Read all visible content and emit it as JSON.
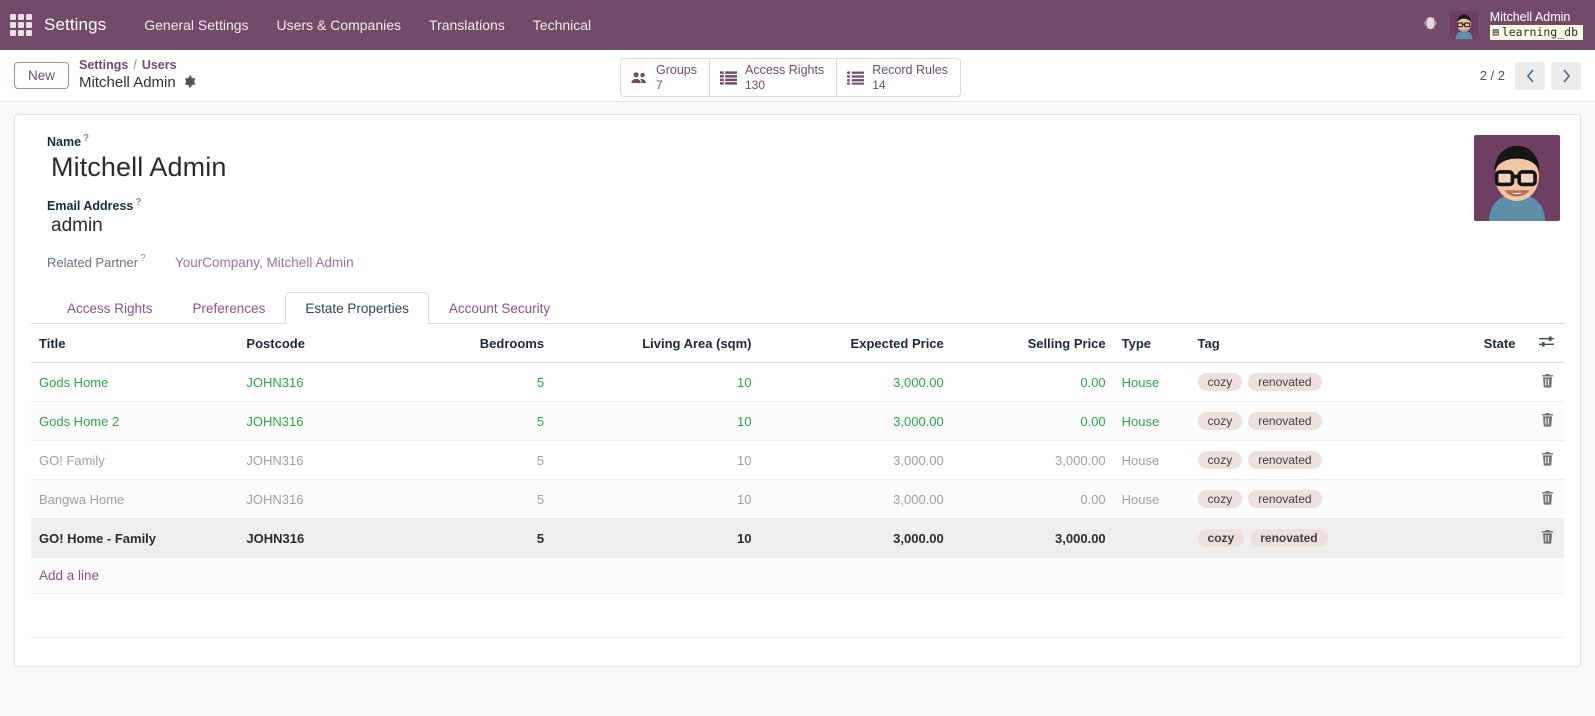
{
  "navbar": {
    "apps_icon": "apps-grid-icon",
    "brand": "Settings",
    "menus": [
      {
        "label": "General Settings"
      },
      {
        "label": "Users & Companies"
      },
      {
        "label": "Translations"
      },
      {
        "label": "Technical"
      }
    ],
    "debug_icon": "bug-icon",
    "user_name": "Mitchell Admin",
    "database": "learning_db",
    "db_icon": "database-icon",
    "brand_color": "#714B67"
  },
  "control_panel": {
    "new_label": "New",
    "breadcrumb": {
      "root": "Settings",
      "separator": "/",
      "parent": "Users",
      "current": "Mitchell Admin",
      "gear_icon": "gear-icon"
    },
    "stat_buttons": [
      {
        "icon": "users-icon",
        "label": "Groups",
        "value": "7"
      },
      {
        "icon": "list-icon",
        "label": "Access Rights",
        "value": "130"
      },
      {
        "icon": "list-ul-icon",
        "label": "Record Rules",
        "value": "14"
      }
    ],
    "pager": {
      "counter": "2 / 2",
      "prev_icon": "chevron-left-icon",
      "next_icon": "chevron-right-icon"
    }
  },
  "form": {
    "name_label": "Name",
    "name_value": "Mitchell Admin",
    "email_label": "Email Address",
    "email_value": "admin",
    "partner_label": "Related Partner",
    "partner_value": "YourCompany, Mitchell Admin",
    "help_mark": "?",
    "avatar_alt": "user-avatar"
  },
  "notebook": {
    "tabs": [
      {
        "label": "Access Rights",
        "active": false
      },
      {
        "label": "Preferences",
        "active": false
      },
      {
        "label": "Estate Properties",
        "active": true
      },
      {
        "label": "Account Security",
        "active": false
      }
    ]
  },
  "list": {
    "columns": [
      {
        "label": "Title",
        "align": "left"
      },
      {
        "label": "Postcode",
        "align": "left"
      },
      {
        "label": "Bedrooms",
        "align": "right"
      },
      {
        "label": "Living Area (sqm)",
        "align": "right"
      },
      {
        "label": "Expected Price",
        "align": "right"
      },
      {
        "label": "Selling Price",
        "align": "right"
      },
      {
        "label": "Type",
        "align": "left"
      },
      {
        "label": "Tag",
        "align": "left"
      },
      {
        "label": "State",
        "align": "right"
      }
    ],
    "optional_columns_icon": "sliders-icon",
    "delete_icon": "trash-icon",
    "rows": [
      {
        "title": "Gods Home",
        "postcode": "JOHN316",
        "bedrooms": "5",
        "living_area": "10",
        "expected_price": "3,000.00",
        "selling_price": "0.00",
        "type": "House",
        "tags": [
          "cozy",
          "renovated"
        ],
        "state": "",
        "decoration": "success",
        "striped": false,
        "selected": false
      },
      {
        "title": "Gods Home 2",
        "postcode": "JOHN316",
        "bedrooms": "5",
        "living_area": "10",
        "expected_price": "3,000.00",
        "selling_price": "0.00",
        "type": "House",
        "tags": [
          "cozy",
          "renovated"
        ],
        "state": "",
        "decoration": "success",
        "striped": true,
        "selected": false
      },
      {
        "title": "GO! Family",
        "postcode": "JOHN316",
        "bedrooms": "5",
        "living_area": "10",
        "expected_price": "3,000.00",
        "selling_price": "3,000.00",
        "type": "House",
        "tags": [
          "cozy",
          "renovated"
        ],
        "state": "",
        "decoration": "muted",
        "striped": false,
        "selected": false
      },
      {
        "title": "Bangwa Home",
        "postcode": "JOHN316",
        "bedrooms": "5",
        "living_area": "10",
        "expected_price": "3,000.00",
        "selling_price": "0.00",
        "type": "House",
        "tags": [
          "cozy",
          "renovated"
        ],
        "state": "",
        "decoration": "muted",
        "striped": true,
        "selected": false
      },
      {
        "title": "GO! Home - Family",
        "postcode": "JOHN316",
        "bedrooms": "5",
        "living_area": "10",
        "expected_price": "3,000.00",
        "selling_price": "3,000.00",
        "type": "",
        "tags": [
          "cozy",
          "renovated"
        ],
        "state": "",
        "decoration": "bold",
        "striped": false,
        "selected": true
      }
    ],
    "add_line_label": "Add a line"
  },
  "colors": {
    "brand_purple": "#714B67",
    "link_purple": "#8f4f8a",
    "success_green": "#28a745",
    "muted_gray": "#9aa0a6",
    "tag_bg": "#efe0e0"
  }
}
